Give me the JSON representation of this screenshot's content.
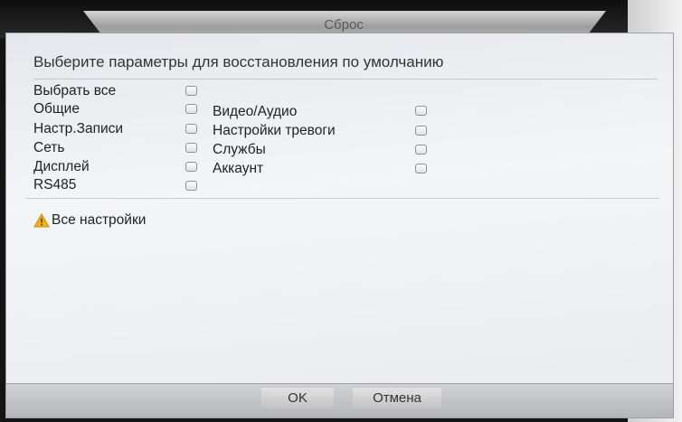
{
  "dialog": {
    "title": "Сброс",
    "header": "Выберите параметры для восстановления по умолчанию"
  },
  "options": {
    "select_all": "Выбрать все",
    "general": "Общие",
    "record": "Настр.Записи",
    "network": "Сеть",
    "display": "Дисплей",
    "rs485": "RS485",
    "video_audio": "Видео/Аудио",
    "alarm": "Настройки тревоги",
    "services": "Службы",
    "account": "Аккаунт"
  },
  "warning": {
    "text": "Все настройки",
    "icon": "warning-icon",
    "icon_color": "#f2b01e"
  },
  "buttons": {
    "ok": "OK",
    "cancel": "Отмена"
  }
}
